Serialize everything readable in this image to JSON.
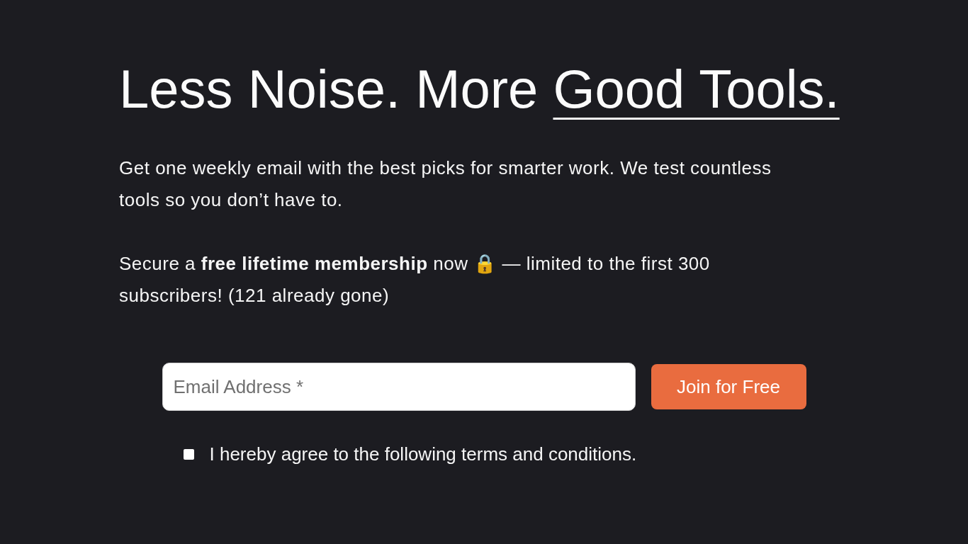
{
  "headline": {
    "parts": [
      {
        "text": "Less Noise. More",
        "underlined": false
      },
      {
        "text": "Good Tools.",
        "underlined": true
      }
    ]
  },
  "intro": [
    "Get one weekly email with the best picks for smarter work. We test countless tools so you don’t have to.",
    "Secure a **free lifetime membership** now 🔒 — limited to the first 300 subscribers! (121 already gone)"
  ],
  "signup": {
    "email": {
      "placeholder": "Email Address *"
    },
    "submit": "Join for Free",
    "consent": {
      "label": "I hereby agree to the following terms and conditions.",
      "checked": false
    }
  }
}
